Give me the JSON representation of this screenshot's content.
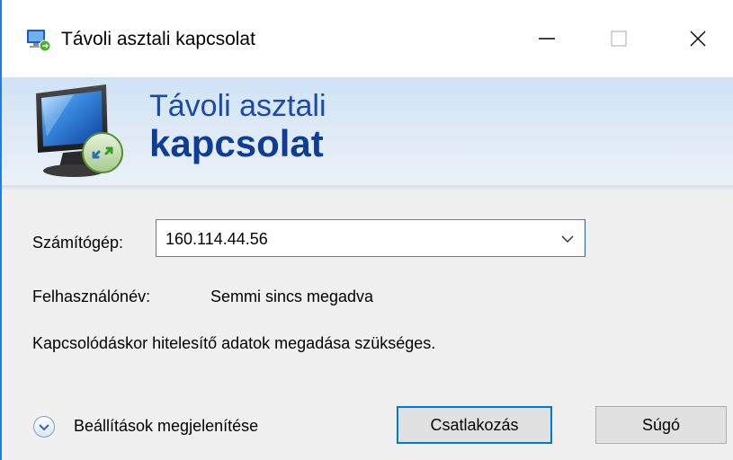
{
  "window": {
    "title": "Távoli asztali kapcsolat",
    "controls": {
      "minimize_icon": "minimize-icon",
      "maximize_icon": "maximize-icon",
      "close_icon": "close-icon"
    }
  },
  "banner": {
    "line1": "Távoli asztali",
    "line2": "kapcsolat"
  },
  "form": {
    "computer_label": "Számítógép:",
    "computer_value": "160.114.44.56",
    "username_label": "Felhasználónév:",
    "username_value": "Semmi sincs megadva",
    "info_text": "Kapcsolódáskor hitelesítő adatok megadása szükséges."
  },
  "footer": {
    "show_options": "Beállítások megjelenítése",
    "connect_label": "Csatlakozás",
    "help_label": "Súgó"
  },
  "colors": {
    "accent": "#0078d7",
    "banner_title": "#0f3d96",
    "window_border": "#2b7ad6"
  }
}
